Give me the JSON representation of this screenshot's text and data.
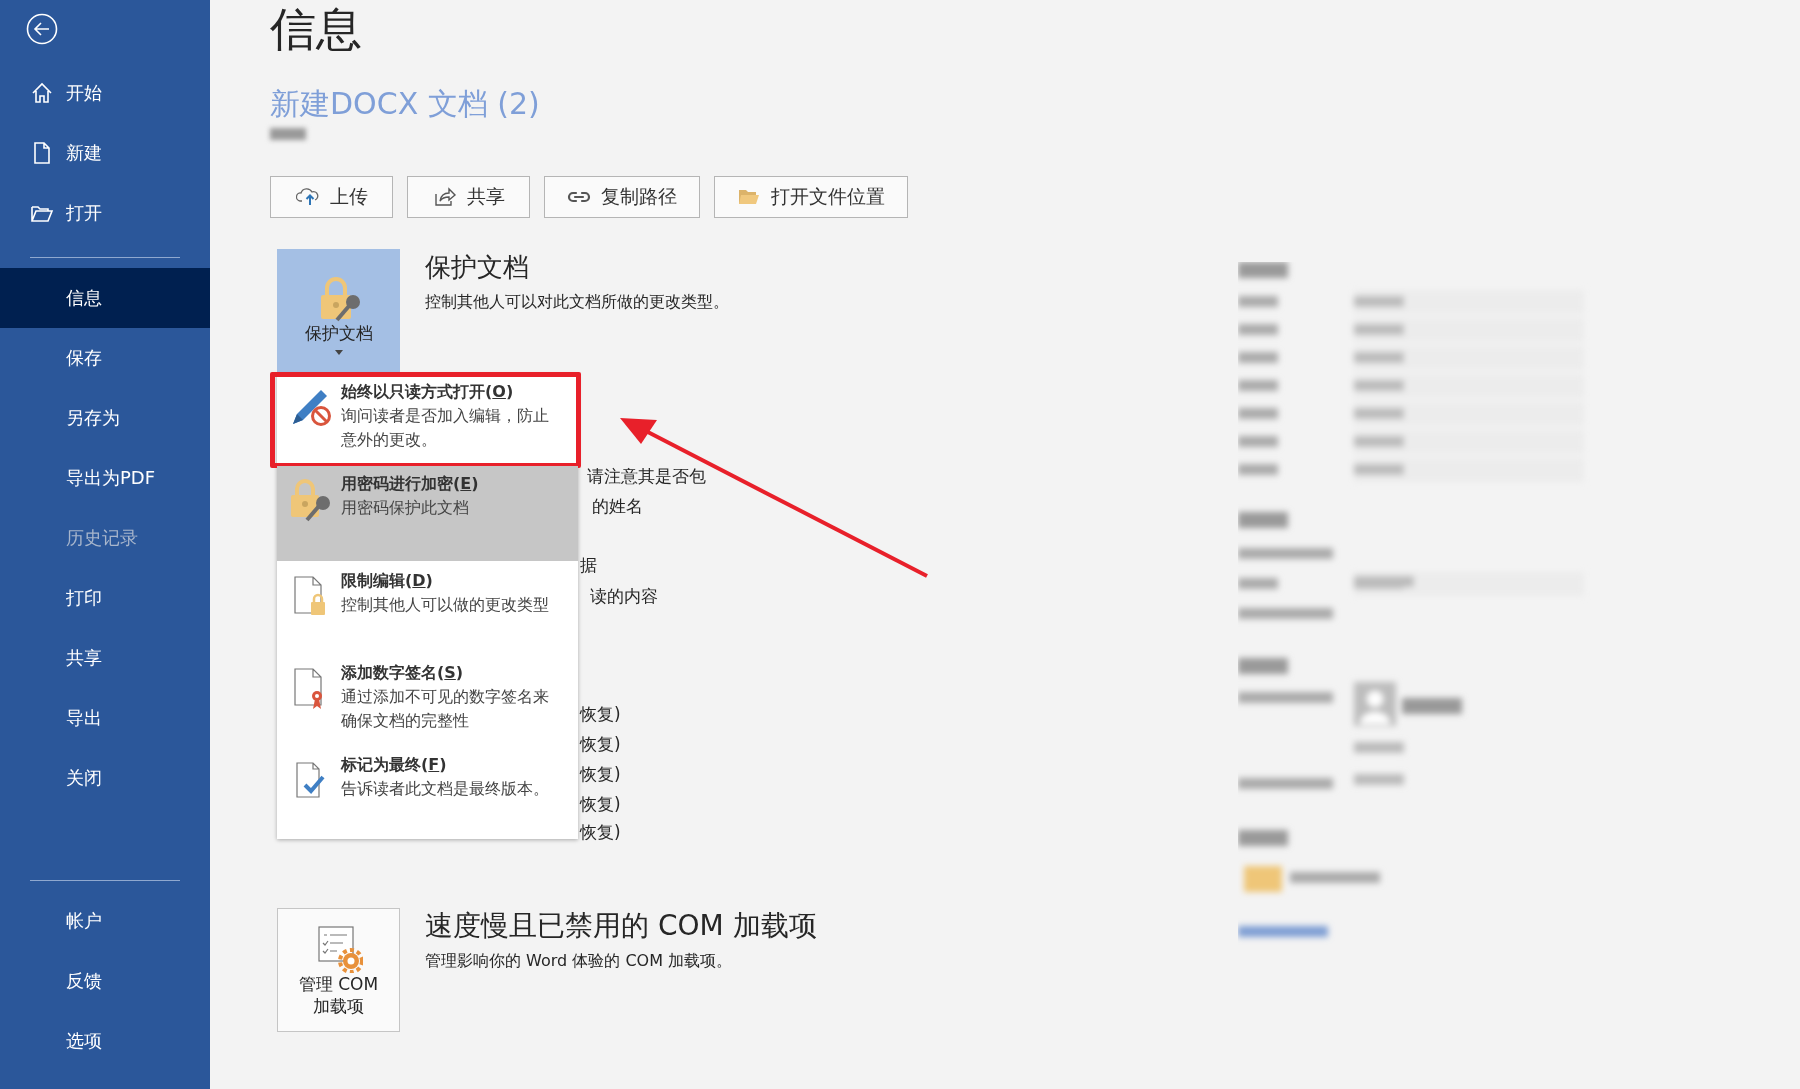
{
  "sidebar": {
    "top_items": [
      {
        "label": "开始",
        "selected": false,
        "disabled": false
      },
      {
        "label": "新建",
        "selected": false,
        "disabled": false
      },
      {
        "label": "打开",
        "selected": false,
        "disabled": false
      }
    ],
    "middle_items": [
      {
        "label": "信息",
        "selected": true,
        "disabled": false
      },
      {
        "label": "保存",
        "selected": false,
        "disabled": false
      },
      {
        "label": "另存为",
        "selected": false,
        "disabled": false
      },
      {
        "label": "导出为PDF",
        "selected": false,
        "disabled": false
      },
      {
        "label": "历史记录",
        "selected": false,
        "disabled": true
      },
      {
        "label": "打印",
        "selected": false,
        "disabled": false
      },
      {
        "label": "共享",
        "selected": false,
        "disabled": false
      },
      {
        "label": "导出",
        "selected": false,
        "disabled": false
      },
      {
        "label": "关闭",
        "selected": false,
        "disabled": false
      }
    ],
    "bottom_items": [
      {
        "label": "帐户",
        "selected": false,
        "disabled": false
      },
      {
        "label": "反馈",
        "selected": false,
        "disabled": false
      },
      {
        "label": "选项",
        "selected": false,
        "disabled": false
      }
    ]
  },
  "page_title": "信息",
  "document": {
    "name": "新建DOCX 文档 (2)"
  },
  "actions": [
    {
      "label": "上传"
    },
    {
      "label": "共享"
    },
    {
      "label": "复制路径"
    },
    {
      "label": "打开文件位置"
    }
  ],
  "protect": {
    "tile_label": "保护文档",
    "heading": "保护文档",
    "description": "控制其他人可以对此文档所做的更改类型。",
    "menu": [
      {
        "title_before": "始终以只读方式打开(",
        "access_key": "O",
        "title_after": ")",
        "description": "询问读者是否加入编辑，防止意外的更改。",
        "selected": false,
        "highlighted": true
      },
      {
        "title_before": "用密码进行加密(",
        "access_key": "E",
        "title_after": ")",
        "description": "用密码保护此文档",
        "selected": true,
        "highlighted": false
      },
      {
        "title_before": "限制编辑(",
        "access_key": "D",
        "title_after": ")",
        "description": "控制其他人可以做的更改类型",
        "selected": false,
        "highlighted": false
      },
      {
        "title_before": "添加数字签名(",
        "access_key": "S",
        "title_after": ")",
        "description": "通过添加不可见的数字签名来确保文档的完整性",
        "selected": false,
        "highlighted": false
      },
      {
        "title_before": "标记为最终(",
        "access_key": "F",
        "title_after": ")",
        "description": "告诉读者此文档是最终版本。",
        "selected": false,
        "highlighted": false
      }
    ]
  },
  "covered_text": [
    "请注意其是否包",
    "的姓名",
    "据",
    "读的内容",
    "恢复)",
    "恢复)",
    "恢复)",
    "恢复)",
    "恢复)"
  ],
  "addins": {
    "tile_label": "管理 COM 加载项",
    "heading": "速度慢且已禁用的 COM 加载项",
    "description": "管理影响你的 Word 体验的 COM 加载项。"
  },
  "annotations": [
    {
      "kind": "arrow"
    }
  ]
}
